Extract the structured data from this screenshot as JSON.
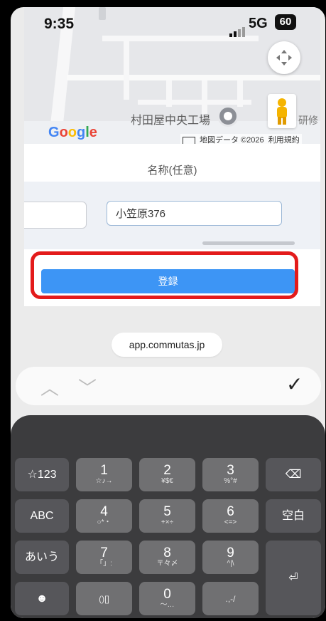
{
  "status": {
    "time": "9:35",
    "network": "5G",
    "battery": "60"
  },
  "map": {
    "poi_label": "村田屋中央工場",
    "edge_text": "研修",
    "google_logo": "Google",
    "attribution": "地図データ ©2026",
    "terms": "利用規約",
    "icons": [
      "compass-icon",
      "pegman-icon",
      "keyboard-icon"
    ]
  },
  "form": {
    "name_label": "名称(任意)",
    "name_value": "小笠原376",
    "register_label": "登録"
  },
  "browser": {
    "url": "app.commutas.jp"
  },
  "keyboard_nav": {
    "up": "︿",
    "down": "﹀",
    "done": "✓"
  },
  "keyboard": {
    "row1": [
      {
        "main": "☆123",
        "sub": ""
      },
      {
        "main": "1",
        "sub": "☆♪→"
      },
      {
        "main": "2",
        "sub": "¥$€"
      },
      {
        "main": "3",
        "sub": "%°#"
      },
      {
        "main": "⌫",
        "sub": ""
      }
    ],
    "row2": [
      {
        "main": "ABC",
        "sub": ""
      },
      {
        "main": "4",
        "sub": "○*・"
      },
      {
        "main": "5",
        "sub": "+×÷"
      },
      {
        "main": "6",
        "sub": "<=>"
      },
      {
        "main": "空白",
        "sub": ""
      }
    ],
    "row3": [
      {
        "main": "あいう",
        "sub": ""
      },
      {
        "main": "7",
        "sub": "「」:"
      },
      {
        "main": "8",
        "sub": "〒々〆"
      },
      {
        "main": "9",
        "sub": "^|\\"
      },
      {
        "main": "⏎",
        "sub": ""
      }
    ],
    "row4": [
      {
        "main": "☻",
        "sub": ""
      },
      {
        "main": "()[]",
        "sub": ""
      },
      {
        "main": "0",
        "sub": "〜…"
      },
      {
        "main": ".,-/",
        "sub": ""
      }
    ]
  },
  "colors": {
    "accent": "#3d95f5",
    "highlight": "#e31b1b"
  }
}
